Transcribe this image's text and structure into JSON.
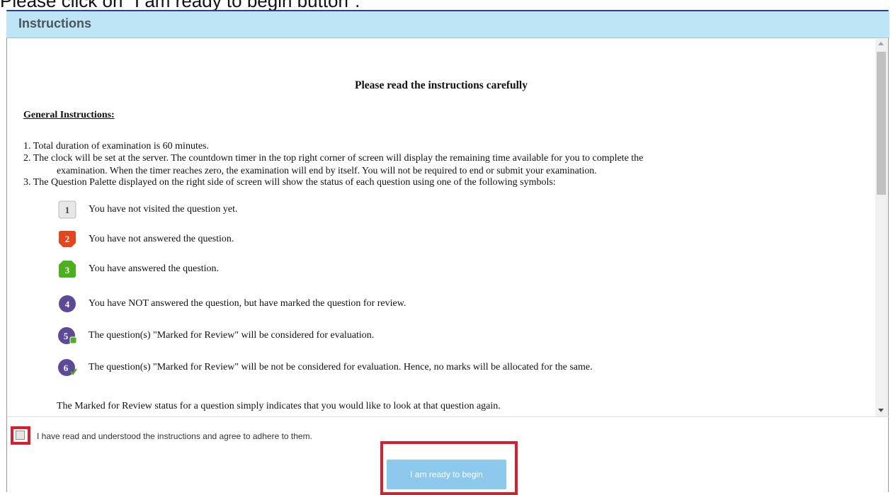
{
  "top_caption": "Please click on \"I am ready to begin button\".",
  "panel": {
    "title": "Instructions"
  },
  "instructions": {
    "heading": "Please read the instructions carefully",
    "subheading": "General Instructions:",
    "line1": "1. Total duration of examination is 60 minutes.",
    "line2a": "2. The clock will be set at the server. The countdown timer in the top right corner of screen will display the remaining time available for you to complete the",
    "line2b": "examination. When the timer reaches zero, the examination will end by itself. You will not be required to end or submit your examination.",
    "line3": "3. The Question Palette displayed on the right side of screen will show the status of each question using one of the following symbols:",
    "symbols": [
      {
        "num": "1",
        "text": "You have not visited the question yet.",
        "color": "#e5e5e5"
      },
      {
        "num": "2",
        "text": "You have not answered the question.",
        "color": "#e2461f"
      },
      {
        "num": "3",
        "text": "You have answered the question.",
        "color": "#4caf1f"
      },
      {
        "num": "4",
        "text": "You have NOT answered the question, but have marked the question for review.",
        "color": "#5c4a96"
      },
      {
        "num": "5",
        "text": "The question(s) \"Marked for Review\" will be considered for evaluation.",
        "color": "#5c4a96"
      },
      {
        "num": "6",
        "text": "The question(s) \"Marked for Review\" will be not be considered for evaluation. Hence, no marks will be allocated for the same.",
        "color": "#5c4a96"
      }
    ],
    "note": "The Marked for Review status for a question simply indicates that you would like to look at that question again."
  },
  "agreement": {
    "label": "I have read and understood the instructions and agree to adhere to them.",
    "checked": false
  },
  "ready_button": {
    "label": "I am ready to begin",
    "color": "#8cc9ec"
  },
  "highlight_color": "#d8202c"
}
